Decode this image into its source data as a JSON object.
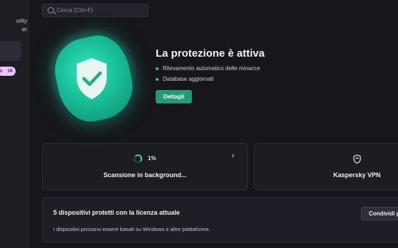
{
  "sidebar": {
    "product_name_line1": "urity",
    "product_name_line2": "er",
    "ai_badge": "IA"
  },
  "search": {
    "placeholder": "Cerca (Ctrl+F)"
  },
  "protection": {
    "title": "La protezione è attiva",
    "bullets": [
      "Rilevamento automatico delle minacce",
      "Database aggiornati"
    ],
    "details_button": "Dettagli"
  },
  "scan": {
    "percent": "1%",
    "label": "Scansione in background..."
  },
  "vpn": {
    "label": "Kaspersky VPN"
  },
  "devices": {
    "title": "5 dispositivi protetti con la licenza attuale",
    "description": "I dispositivi possono essere basati su Windows e altre piattaforme.",
    "share_button": "Condividi p"
  },
  "colors": {
    "accent": "#23c79c",
    "button": "#1f9c7a",
    "background": "#16161c"
  }
}
